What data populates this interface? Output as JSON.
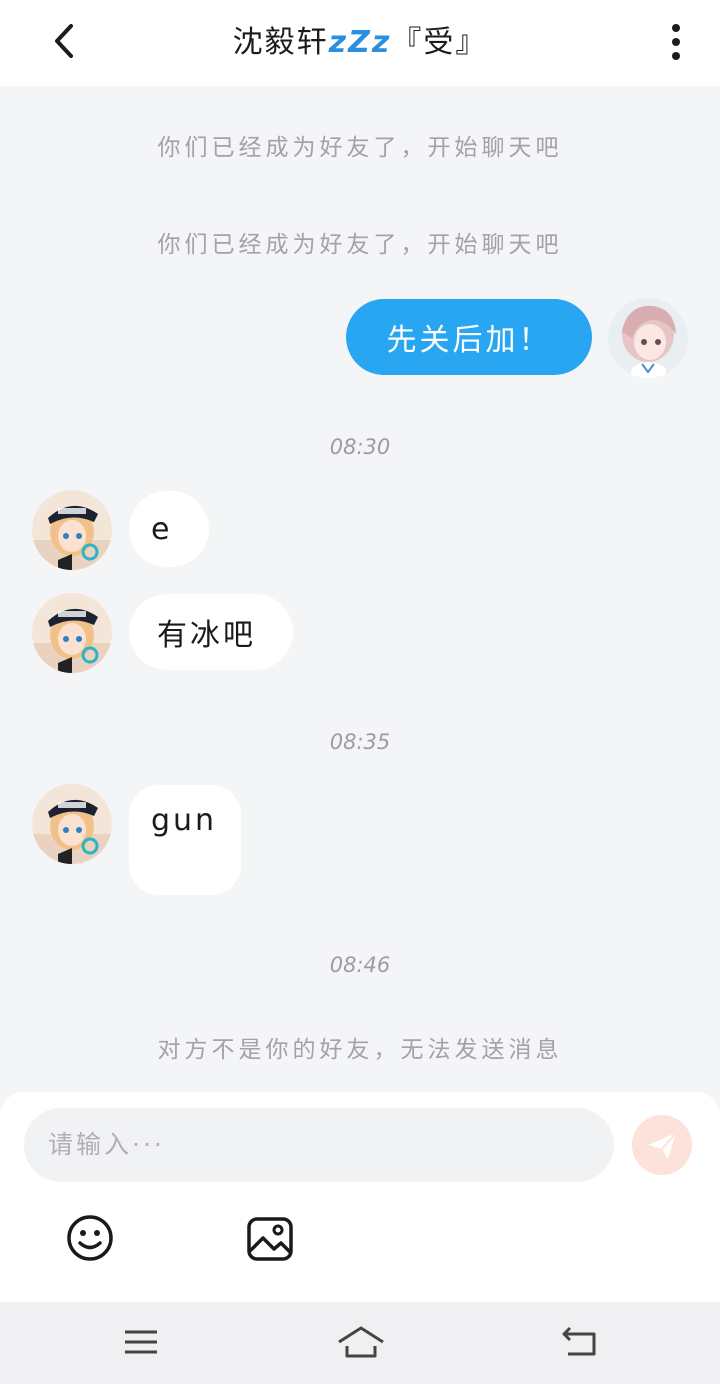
{
  "header": {
    "title_name": "沈毅轩",
    "title_emoji": "zZz",
    "title_suffix": "『受』"
  },
  "messages": {
    "system_1": "你们已经成为好友了，开始聊天吧",
    "system_2": "你们已经成为好友了，开始聊天吧",
    "outgoing_1": "先关后加！",
    "time_1": "08:30",
    "incoming_1": "e",
    "incoming_2": "有冰吧",
    "time_2": "08:35",
    "incoming_3": "gun",
    "time_3": "08:46",
    "system_3": "对方不是你的好友，无法发送消息"
  },
  "input": {
    "placeholder": "请输入···"
  },
  "icons": {
    "back": "chevron-left-icon",
    "more": "more-vertical-icon",
    "send": "send-icon",
    "emoji": "smiley-icon",
    "image": "image-icon",
    "nav_menu": "menu-icon",
    "nav_home": "home-icon",
    "nav_back": "return-icon"
  },
  "colors": {
    "outgoing_bubble": "#29a6f2",
    "incoming_bubble": "#ffffff",
    "chat_background": "#f4f5f7",
    "send_button_disabled": "#fde1db"
  }
}
